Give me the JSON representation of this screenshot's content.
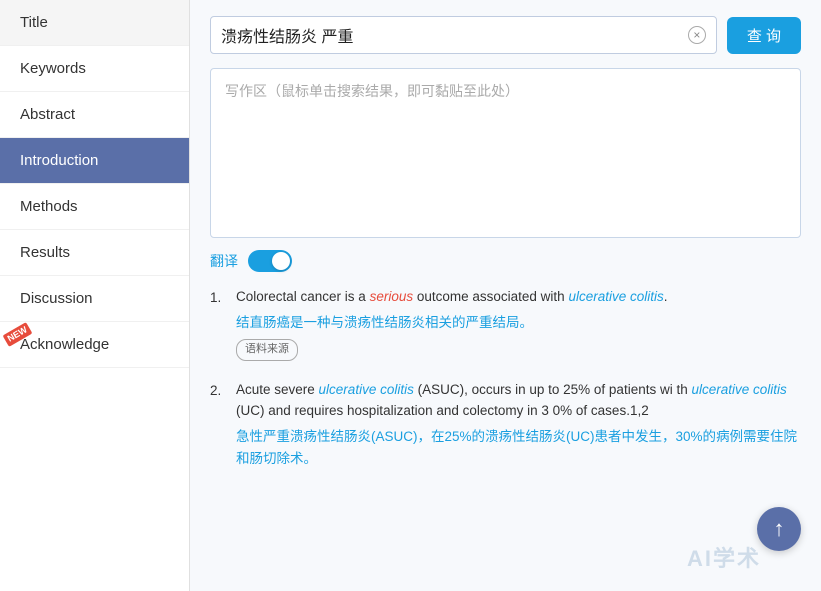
{
  "sidebar": {
    "items": [
      {
        "id": "title",
        "label": "Title",
        "active": false,
        "new": false
      },
      {
        "id": "keywords",
        "label": "Keywords",
        "active": false,
        "new": false
      },
      {
        "id": "abstract",
        "label": "Abstract",
        "active": false,
        "new": false
      },
      {
        "id": "introduction",
        "label": "Introduction",
        "active": true,
        "new": false
      },
      {
        "id": "methods",
        "label": "Methods",
        "active": false,
        "new": false
      },
      {
        "id": "results",
        "label": "Results",
        "active": false,
        "new": false
      },
      {
        "id": "discussion",
        "label": "Discussion",
        "active": false,
        "new": false
      },
      {
        "id": "acknowledge",
        "label": "Acknowledge",
        "active": false,
        "new": true
      }
    ]
  },
  "search": {
    "query": "溃疡性结肠炎 严重",
    "clear_label": "×",
    "button_label": "查 询",
    "placeholder": "写作区（鼠标单击搜索结果，即可黏贴至此处）"
  },
  "translate": {
    "label": "翻译",
    "enabled": true
  },
  "results": [
    {
      "number": "1.",
      "en_parts": [
        {
          "text": "Colorectal cancer is a ",
          "style": "normal"
        },
        {
          "text": "serious",
          "style": "italic-red"
        },
        {
          "text": " outcome associated with ",
          "style": "normal"
        },
        {
          "text": "ulcerative colitis",
          "style": "italic-link"
        },
        {
          "text": ".",
          "style": "normal"
        }
      ],
      "zh": "结直肠癌是一种与溃疡性结肠炎相关的严重结局。",
      "zh_parts": [
        {
          "text": "结直肠癌是一种与",
          "style": "normal"
        },
        {
          "text": "溃疡性结肠炎",
          "style": "link"
        },
        {
          "text": "相关的",
          "style": "normal"
        },
        {
          "text": "严重",
          "style": "link"
        },
        {
          "text": "结局。",
          "style": "normal"
        }
      ],
      "tag": "语料来源"
    },
    {
      "number": "2.",
      "en_parts": [
        {
          "text": "Acute severe ",
          "style": "normal"
        },
        {
          "text": "ulcerative colitis",
          "style": "italic-link"
        },
        {
          "text": " (ASUC), occurs in up to 25% of patients wi th ",
          "style": "normal"
        },
        {
          "text": "ulcerative colitis",
          "style": "italic-link"
        },
        {
          "text": " (UC) and requires hospitalization and colectomy in 3 0% of cases.1,2",
          "style": "normal"
        }
      ],
      "zh_parts": [
        {
          "text": "急性",
          "style": "normal"
        },
        {
          "text": "严重溃疡性结肠炎",
          "style": "link"
        },
        {
          "text": "(ASUC)，在25%的",
          "style": "normal"
        },
        {
          "text": "溃疡性结肠炎",
          "style": "link"
        },
        {
          "text": "(UC)患者中发生，",
          "style": "normal"
        },
        {
          "text": "30%的",
          "style": "link"
        },
        {
          "text": "病例需要住院和",
          "style": "normal"
        },
        {
          "text": "肠切",
          "style": "link"
        },
        {
          "text": "除术。",
          "style": "normal"
        }
      ],
      "tag": null
    }
  ],
  "watermark": "AI学术",
  "scroll_top": "↑",
  "new_badge_label": "NEW"
}
